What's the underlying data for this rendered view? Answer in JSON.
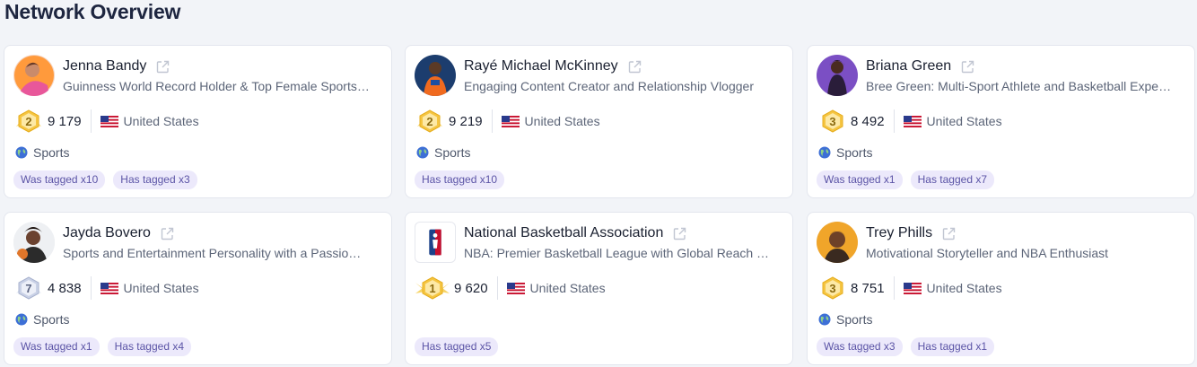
{
  "page": {
    "title": "Network Overview"
  },
  "colors": {
    "accent": "#5b54a6",
    "tag_bg": "#ece9fb",
    "badge_gold": "#f5c542",
    "badge_silver": "#c9d1e6"
  },
  "cards": [
    {
      "name": "Jenna Bandy",
      "description": "Guinness World Record Holder & Top Female Sports…",
      "rank": "2",
      "badge_style": "gold",
      "followers": "9 179",
      "country": "United States",
      "category": "Sports",
      "tags": [
        "Was tagged x10",
        "Has tagged x3"
      ],
      "avatar_icon": "person-photo"
    },
    {
      "name": "Rayé Michael McKinney",
      "description": "Engaging Content Creator and Relationship Vlogger",
      "rank": "2",
      "badge_style": "gold",
      "followers": "9 219",
      "country": "United States",
      "category": "Sports",
      "tags": [
        "Has tagged x10"
      ],
      "avatar_icon": "person-photo"
    },
    {
      "name": "Briana Green",
      "description": "Bree Green: Multi-Sport Athlete and Basketball Expe…",
      "rank": "3",
      "badge_style": "gold-plain",
      "followers": "8 492",
      "country": "United States",
      "category": "Sports",
      "tags": [
        "Was tagged x1",
        "Has tagged x7"
      ],
      "avatar_icon": "person-photo"
    },
    {
      "name": "Jayda Bovero",
      "description": "Sports and Entertainment Personality with a Passio…",
      "rank": "7",
      "badge_style": "silver",
      "followers": "4 838",
      "country": "United States",
      "category": "Sports",
      "tags": [
        "Was tagged x1",
        "Has tagged x4"
      ],
      "avatar_icon": "person-photo"
    },
    {
      "name": "National Basketball Association",
      "description": "NBA: Premier Basketball League with Global Reach …",
      "rank": "1",
      "badge_style": "gold-wings",
      "followers": "9 620",
      "country": "United States",
      "category": "",
      "tags": [
        "Has tagged x5"
      ],
      "avatar_icon": "nba-logo"
    },
    {
      "name": "Trey Phills",
      "description": "Motivational Storyteller and NBA Enthusiast",
      "rank": "3",
      "badge_style": "gold-plain",
      "followers": "8 751",
      "country": "United States",
      "category": "Sports",
      "tags": [
        "Was tagged x3",
        "Has tagged x1"
      ],
      "avatar_icon": "person-photo"
    }
  ]
}
